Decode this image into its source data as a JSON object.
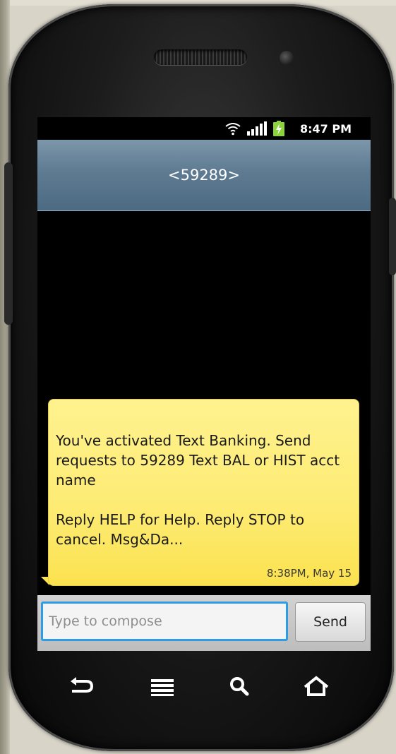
{
  "status_bar": {
    "time": "8:47 PM",
    "icons": [
      "wifi-icon",
      "signal-icon",
      "battery-charging-icon"
    ]
  },
  "header": {
    "title": "<59289>"
  },
  "messages": [
    {
      "text": "You've activated Text Banking. Send requests to 59289 Text BAL or HIST acct name\n\nReply HELP for Help. Reply STOP to cancel. Msg&Da...",
      "timestamp": "8:38PM, May 15"
    }
  ],
  "compose": {
    "placeholder": "Type to compose",
    "value": "",
    "send_label": "Send"
  },
  "nav_buttons": [
    "back-icon",
    "menu-icon",
    "search-icon",
    "home-icon"
  ],
  "colors": {
    "header_bg": "#5e7b92",
    "bubble_bg": "#fdeb72",
    "input_border": "#2e9be6",
    "screen_bg": "#000000"
  }
}
